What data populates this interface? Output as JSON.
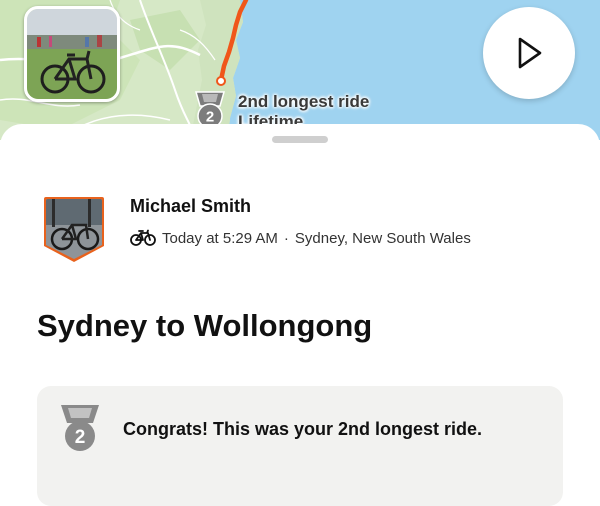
{
  "map": {
    "achievement_label_line1": "2nd longest ride",
    "achievement_label_line2": "Lifetime",
    "medal_rank": "2",
    "colors": {
      "water": "#9fd3f0",
      "land": "#d6e8c6",
      "route": "#f0561a",
      "road": "#ffffff"
    },
    "play_icon": "play-icon",
    "photo_icon": "ride-photo"
  },
  "activity": {
    "athlete_name": "Michael Smith",
    "sport_icon": "bike-icon",
    "timestamp": "Today at 5:29 AM",
    "separator": "·",
    "location": "Sydney, New South Wales",
    "title": "Sydney to Wollongong"
  },
  "achievement": {
    "medal_rank": "2",
    "message": "Congrats! This was your 2nd longest ride."
  },
  "colors": {
    "accent": "#f0561a",
    "medal_gray": "#8a8a8a",
    "card_bg": "#f2f2f0"
  }
}
